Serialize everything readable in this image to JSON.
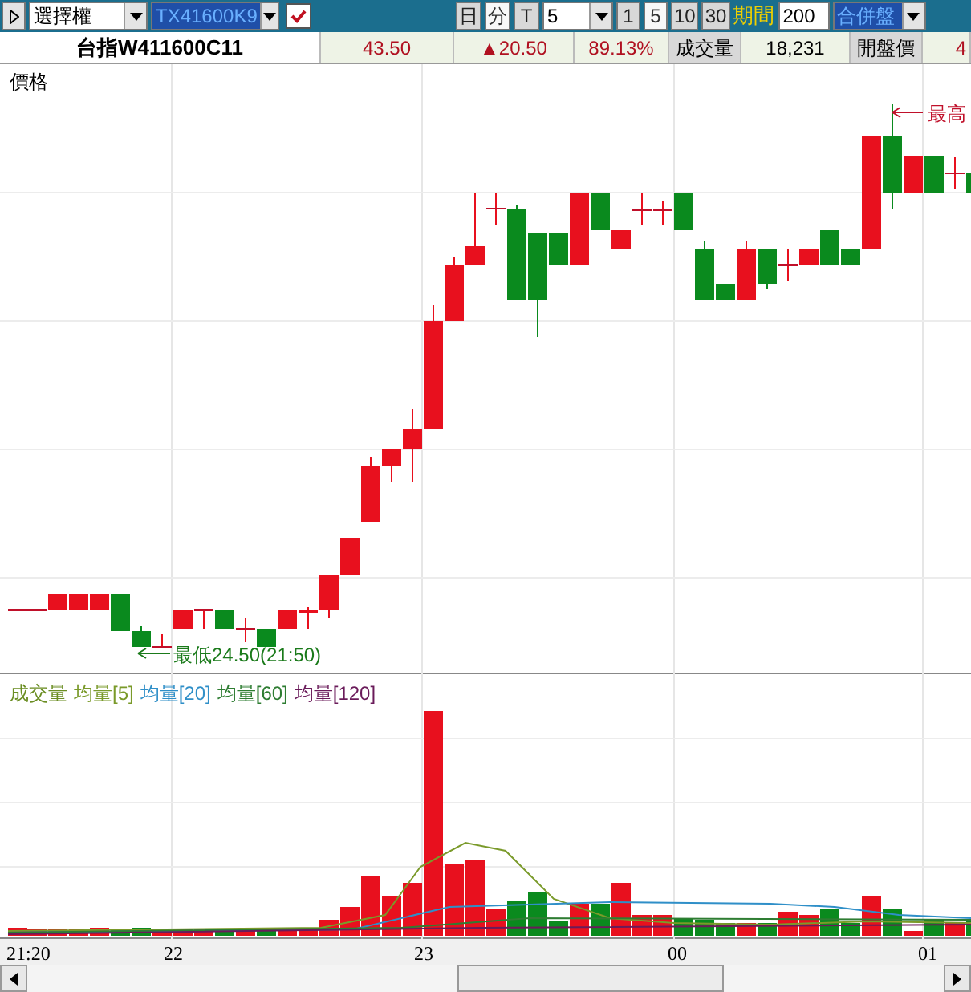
{
  "toolbar": {
    "market_select": {
      "value": "選擇權"
    },
    "contract_select": {
      "value": "TX41600K9"
    },
    "checkbox": {
      "checked": true
    },
    "period_buttons": [
      {
        "label": "日",
        "selected": false
      },
      {
        "label": "分",
        "selected": true
      },
      {
        "label": "T",
        "selected": false
      }
    ],
    "interval_select": {
      "value": "5"
    },
    "minute_buttons": [
      {
        "label": "1",
        "selected": false
      },
      {
        "label": "5",
        "selected": true
      },
      {
        "label": "10",
        "selected": false
      },
      {
        "label": "30",
        "selected": false
      }
    ],
    "range_label": "期間",
    "range_input": {
      "value": "200"
    },
    "mode_select": {
      "value": "合併盤"
    }
  },
  "info_bar": [
    {
      "kind": "name",
      "text": "台指W411600C11"
    },
    {
      "kind": "value",
      "text": "43.50"
    },
    {
      "kind": "value",
      "text": "▲20.50"
    },
    {
      "kind": "value",
      "text": "89.13%"
    },
    {
      "kind": "label",
      "text": "成交量"
    },
    {
      "kind": "number",
      "text": "18,231"
    },
    {
      "kind": "label",
      "text": "開盤價"
    },
    {
      "kind": "value",
      "text": "4"
    }
  ],
  "price_chart": {
    "title": "價格",
    "low_annotation": "最低24.50(21:50)",
    "high_annotation": "最高"
  },
  "volume_chart": {
    "legend": [
      {
        "label": "成交量",
        "color": "#6b8e23"
      },
      {
        "label": "均量[5]",
        "color": "#7a9a2a"
      },
      {
        "label": "均量[20]",
        "color": "#2f8fc8"
      },
      {
        "label": "均量[60]",
        "color": "#2e7d32"
      },
      {
        "label": "均量[120]",
        "color": "#6a1b5a"
      }
    ]
  },
  "time_axis": [
    "21:20",
    "22",
    "23",
    "00",
    "01"
  ]
}
